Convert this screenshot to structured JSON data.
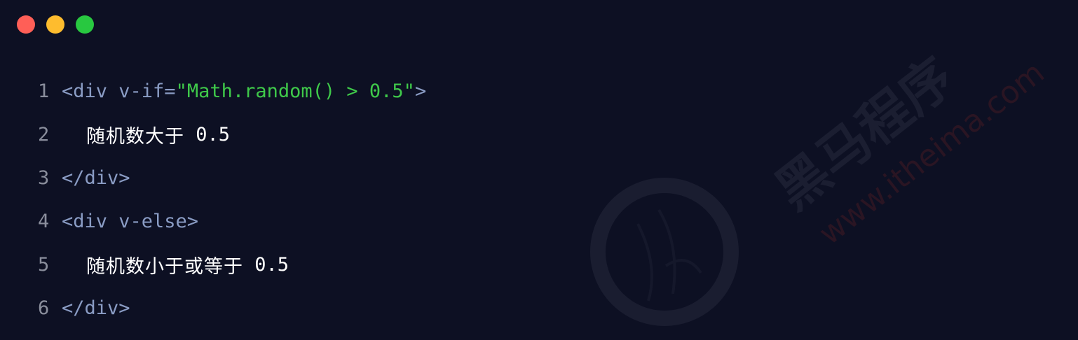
{
  "window": {
    "traffic_lights": {
      "close_color": "#ff5f57",
      "minimize_color": "#febc2e",
      "maximize_color": "#28c840"
    }
  },
  "code": {
    "lines": [
      {
        "number": "1",
        "open": "<div",
        "attr": " v-if=",
        "value": "\"Math.random() > 0.5\"",
        "close": ">"
      },
      {
        "number": "2",
        "text": "随机数大于",
        "num": " 0.5"
      },
      {
        "number": "3",
        "tag": "</div>"
      },
      {
        "number": "4",
        "tag": "<div v-else>"
      },
      {
        "number": "5",
        "text": "随机数小于或等于",
        "num": " 0.5"
      },
      {
        "number": "6",
        "tag": "</div>"
      }
    ]
  },
  "watermark": {
    "text_cn": "黑马程序",
    "text_url": "www.itheima.com"
  }
}
